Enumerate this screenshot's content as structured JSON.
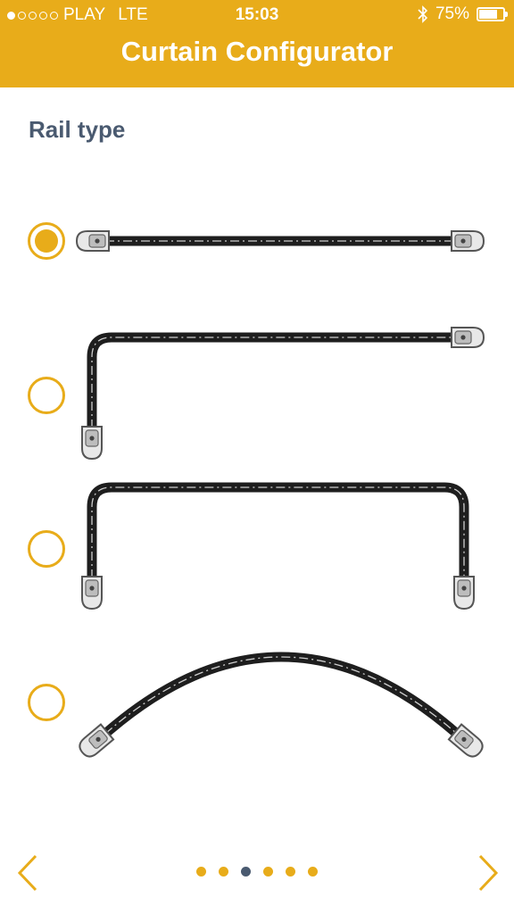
{
  "status": {
    "carrier": "PLAY",
    "network": "LTE",
    "time": "15:03",
    "battery": "75%",
    "battery_level": 0.75,
    "signal_bars_filled": 1,
    "signal_bars_total": 5
  },
  "header": {
    "title": "Curtain Configurator"
  },
  "section": {
    "title": "Rail type"
  },
  "options": [
    {
      "shape": "straight",
      "selected": true
    },
    {
      "shape": "l-shape",
      "selected": false
    },
    {
      "shape": "u-shape",
      "selected": false
    },
    {
      "shape": "arc",
      "selected": false
    }
  ],
  "pager": {
    "count": 6,
    "active_index": 2
  },
  "colors": {
    "accent": "#e8ac1a",
    "title_text": "#4a5a70",
    "rail": "#1e1e1e"
  },
  "icons": {
    "prev": "chevron-left-icon",
    "next": "chevron-right-icon",
    "bluetooth": "bluetooth-icon",
    "battery": "battery-icon"
  }
}
